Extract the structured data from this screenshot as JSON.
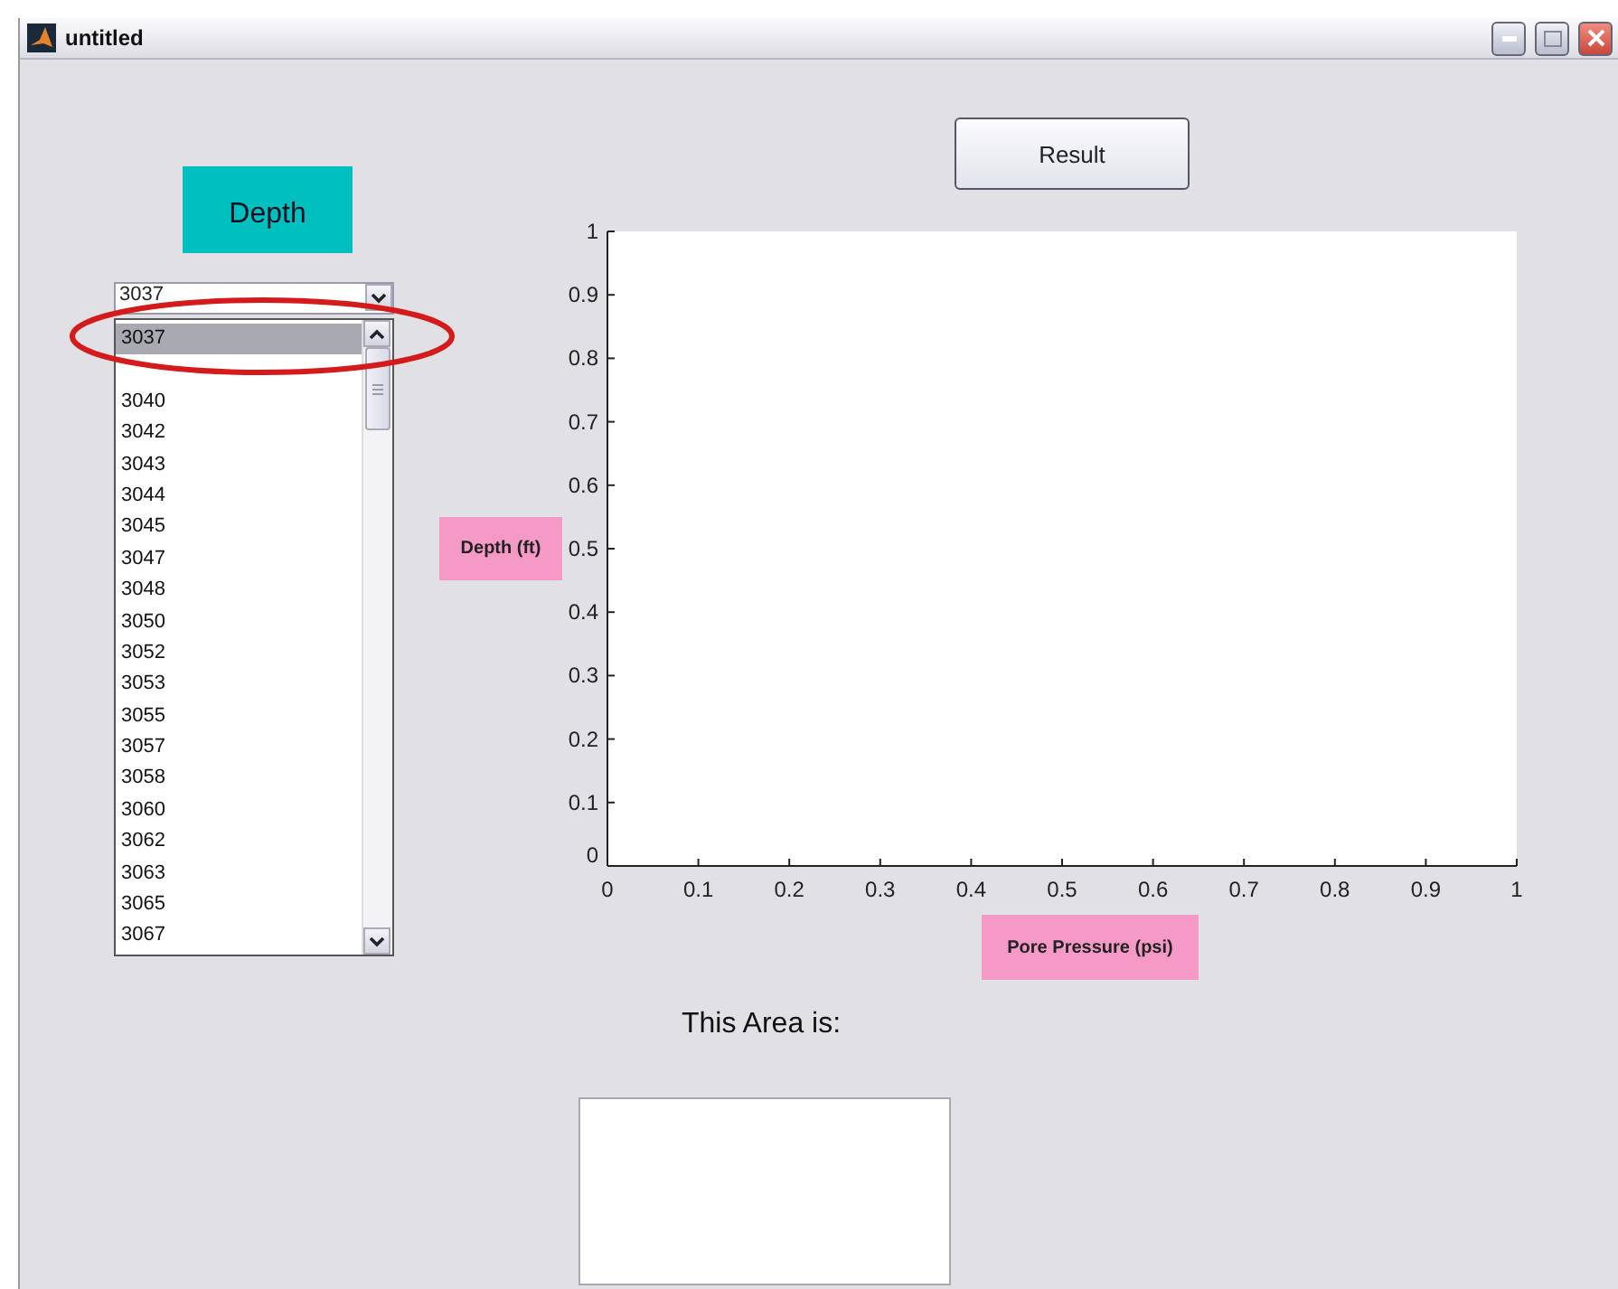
{
  "window": {
    "title": "untitled"
  },
  "result_button": {
    "label": "Result"
  },
  "depth_heading": "Depth",
  "depth_popup": {
    "value": "3037"
  },
  "depth_list": [
    {
      "label": "3037",
      "selected": true
    },
    {
      "selected": false
    },
    {
      "label": "3040",
      "selected": false
    },
    {
      "label": "3042",
      "selected": false
    },
    {
      "label": "3043",
      "selected": false
    },
    {
      "label": "3044",
      "selected": false
    },
    {
      "label": "3045",
      "selected": false
    },
    {
      "label": "3047",
      "selected": false
    },
    {
      "label": "3048",
      "selected": false
    },
    {
      "label": "3050",
      "selected": false
    },
    {
      "label": "3052",
      "selected": false
    },
    {
      "label": "3053",
      "selected": false
    },
    {
      "label": "3055",
      "selected": false
    },
    {
      "label": "3057",
      "selected": false
    },
    {
      "label": "3058",
      "selected": false
    },
    {
      "label": "3060",
      "selected": false
    },
    {
      "label": "3062",
      "selected": false
    },
    {
      "label": "3063",
      "selected": false
    },
    {
      "label": "3065",
      "selected": false
    },
    {
      "label": "3067",
      "selected": false
    }
  ],
  "plot": {
    "y_label": "Depth (ft)",
    "x_label": "Pore Pressure (psi)",
    "chart_data": {
      "type": "line",
      "xlim": [
        0,
        1
      ],
      "ylim": [
        0,
        1
      ],
      "xticks": [
        {
          "value": 0,
          "label": "0"
        },
        {
          "value": 0.1,
          "label": "0.1"
        },
        {
          "value": 0.2,
          "label": "0.2"
        },
        {
          "value": 0.3,
          "label": "0.3"
        },
        {
          "value": 0.4,
          "label": "0.4"
        },
        {
          "value": 0.5,
          "label": "0.5"
        },
        {
          "value": 0.6,
          "label": "0.6"
        },
        {
          "value": 0.7,
          "label": "0.7"
        },
        {
          "value": 0.8,
          "label": "0.8"
        },
        {
          "value": 0.9,
          "label": "0.9"
        },
        {
          "value": 1,
          "label": "1"
        }
      ],
      "yticks": [
        {
          "value": 0,
          "label": "0"
        },
        {
          "value": 0.1,
          "label": "0.1"
        },
        {
          "value": 0.2,
          "label": "0.2"
        },
        {
          "value": 0.3,
          "label": "0.3"
        },
        {
          "value": 0.4,
          "label": "0.4"
        },
        {
          "value": 0.5,
          "label": "0.5"
        },
        {
          "value": 0.6,
          "label": "0.6"
        },
        {
          "value": 0.7,
          "label": "0.7"
        },
        {
          "value": 0.8,
          "label": "0.8"
        },
        {
          "value": 0.9,
          "label": "0.9"
        },
        {
          "value": 1,
          "label": "1"
        }
      ]
    }
  },
  "area_caption": "This Area is:"
}
